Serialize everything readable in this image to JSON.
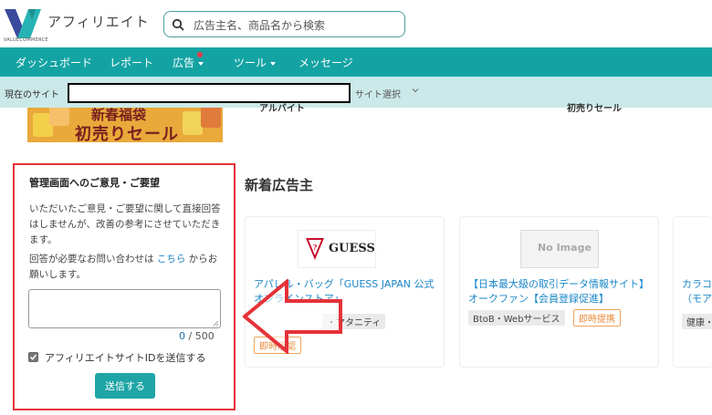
{
  "header": {
    "brand": "アフィリエイト",
    "logo_text": "VALUECOMMERCE",
    "search_placeholder": "広告主名、商品名から検索"
  },
  "nav": {
    "items": [
      {
        "label": "ダッシュボード"
      },
      {
        "label": "レポート"
      },
      {
        "label": "広告"
      },
      {
        "label": "ツール"
      },
      {
        "label": "メッセージ"
      }
    ]
  },
  "sitebar": {
    "label": "現在のサイト",
    "select_label": "サイト選択"
  },
  "banner": {
    "line1": "新春福袋",
    "line2": "初売りセール",
    "partial_left": "アルバイト",
    "partial_right": "初売りセール"
  },
  "feedback": {
    "title": "管理画面へのご意見・ご要望",
    "para1": "いただいたご意見・ご要望に関して直接回答はしませんが、改善の参考にさせていただきます。",
    "para2_prefix": "回答が必要なお問い合わせは ",
    "para2_link": "こちら",
    "para2_suffix": " からお願いします。",
    "count_current": "0",
    "count_sep": " / 500",
    "checkbox_label": "アフィリエイトサイトIDを送信する",
    "submit_label": "送信する"
  },
  "section": {
    "title": "新着広告主"
  },
  "cards": [
    {
      "title": "アパレル・バッグ「GUESS JAPAN 公式オンラインストア」",
      "logo": "GUESS",
      "tags": [
        "・マタニティ",
        "即時承認"
      ]
    },
    {
      "title": "【日本最大級の取引データ情報サイト】オークファン【会員登録促進】",
      "logo": "No Image",
      "tags": [
        "BtoB・Webサービス",
        "即時提携"
      ]
    },
    {
      "title": "カラコ（モア",
      "tags": [
        "健康・"
      ]
    }
  ],
  "colors": {
    "teal": "#14a3a3",
    "sitebar": "#cbe9e9",
    "highlight_red": "#e53238",
    "link_blue": "#1a86c8"
  }
}
